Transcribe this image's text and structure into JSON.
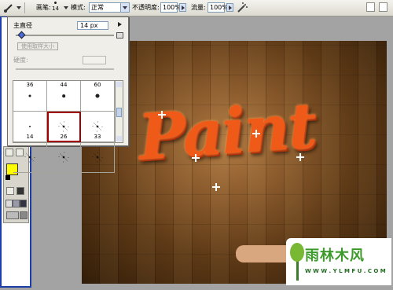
{
  "options_bar": {
    "brush_label": "画笔:",
    "brush_size_value": "14",
    "mode_label": "模式:",
    "mode_value": "正常",
    "opacity_label": "不透明度:",
    "opacity_value": "100%",
    "flow_label": "流量:",
    "flow_value": "100%"
  },
  "brush_panel": {
    "master_diameter_label": "主直径",
    "master_diameter_value": "14 px",
    "master_diameter_fraction": 0.03,
    "use_sample_size_label": "使用取样大小",
    "hardness_label": "硬度:",
    "hardness_value": "",
    "presets": [
      {
        "size": "36",
        "kind": "dot",
        "selected": false
      },
      {
        "size": "44",
        "kind": "dot",
        "selected": false
      },
      {
        "size": "60",
        "kind": "dot",
        "selected": false
      },
      {
        "size": "14",
        "kind": "dot",
        "selected": false
      },
      {
        "size": "26",
        "kind": "spray",
        "selected": true
      },
      {
        "size": "33",
        "kind": "spray",
        "selected": false
      },
      {
        "size": "",
        "kind": "spray",
        "selected": false
      },
      {
        "size": "",
        "kind": "spray",
        "selected": false
      },
      {
        "size": "",
        "kind": "spray",
        "selected": false
      }
    ]
  },
  "canvas": {
    "artwork_text": "Paint"
  },
  "tools": {
    "foreground_color": "#ffff00",
    "background_color": "#b38cd0"
  },
  "watermark": {
    "title": "雨林木风",
    "url": "W W W . Y L M F U . C O M"
  },
  "colors": {
    "accent_selected": "#a00000",
    "frame_blue": "#1c3ea6"
  }
}
